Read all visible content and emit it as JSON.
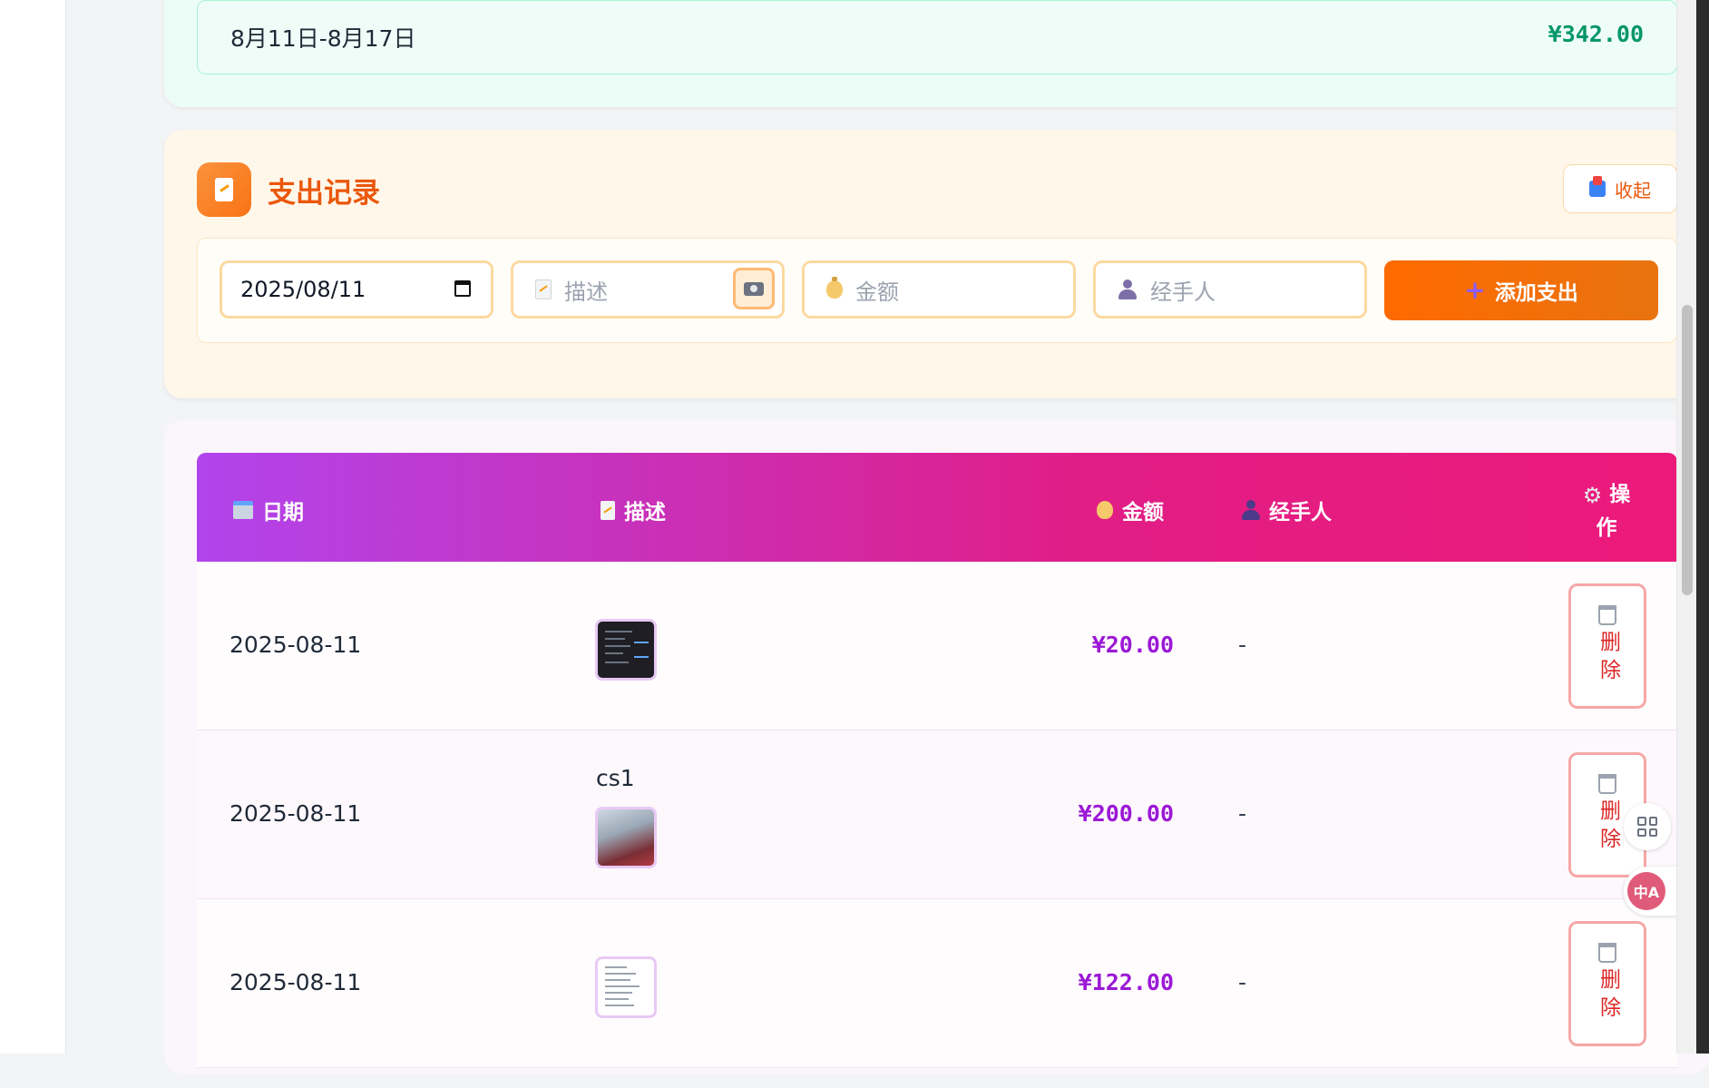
{
  "summary": {
    "range": "8月11日-8月17日",
    "amount": "¥342.00"
  },
  "expense_section": {
    "title": "支出记录",
    "collapse_label": "收起",
    "form": {
      "date_value": "2025/08/11",
      "desc_placeholder": "描述",
      "amount_placeholder": "金额",
      "handler_placeholder": "经手人",
      "add_label": "添加支出"
    }
  },
  "table": {
    "headers": {
      "date": "日期",
      "desc": "描述",
      "amount": "金额",
      "handler": "经手人",
      "ops": "操作"
    },
    "rows": [
      {
        "date": "2025-08-11",
        "desc": "",
        "thumb": "dark-screenshot",
        "amount": "¥20.00",
        "handler": "-",
        "delete_label": "删除"
      },
      {
        "date": "2025-08-11",
        "desc": "cs1",
        "thumb": "photo",
        "amount": "¥200.00",
        "handler": "-",
        "delete_label": "删除"
      },
      {
        "date": "2025-08-11",
        "desc": "",
        "thumb": "document",
        "amount": "¥122.00",
        "handler": "-",
        "delete_label": "删除"
      }
    ]
  },
  "floating_tools": {
    "translate_glyph": "中A"
  },
  "colors": {
    "accent_orange": "#ff6a00",
    "header_gradient_start": "#b144ec",
    "header_gradient_end": "#ec1a7a",
    "amount_purple": "#9b18d6",
    "summary_green": "#059669",
    "delete_red": "#dc2626"
  },
  "icons": [
    "calendar-icon",
    "document-icon",
    "moneybag-icon",
    "person-icon",
    "gear-icon",
    "camera-icon",
    "plus-icon",
    "inbox-icon",
    "trash-icon",
    "apps-icon",
    "translate-icon"
  ]
}
